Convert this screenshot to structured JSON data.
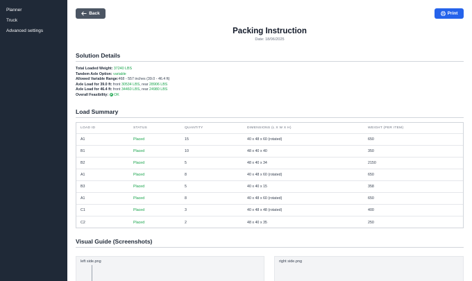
{
  "sidebar": {
    "items": [
      {
        "label": "Planner"
      },
      {
        "label": "Truck"
      },
      {
        "label": "Advanced settings"
      }
    ]
  },
  "header": {
    "back_label": "Back",
    "print_label": "Print",
    "title": "Packing Instruction",
    "date_prefix": "Date:",
    "date_value": "18/06/2025"
  },
  "solution": {
    "heading": "Solution Details",
    "total_weight_label": "Total Loaded Weight:",
    "total_weight_value": "37240 LBS",
    "tandem_label": "Tandem Axle Option:",
    "tandem_value": "variable",
    "range_label": "Allowed Variable Range:",
    "range_value": "468 - 557 inches (39.0 - 46.4 ft)",
    "axle39_label": "Axle Load for 39.0 ft:",
    "axle39_front_label": "front",
    "axle39_front_value": "30534 LBS",
    "axle39_rear_label": ", rear",
    "axle39_rear_value": "28906 LBS",
    "axle46_label": "Axle Load for 46.4 ft:",
    "axle46_front_label": "front",
    "axle46_front_value": "34460 LBS",
    "axle46_rear_label": ", rear",
    "axle46_rear_value": "24980 LBS",
    "feasibility_label": "Overall Feasibility:",
    "feasibility_value": "OK",
    "ok_color": "#16a34a"
  },
  "load_summary": {
    "heading": "Load Summary",
    "columns": [
      "LOAD ID",
      "STATUS",
      "QUANTITY",
      "DIMENSIONS (L X W X H)",
      "WEIGHT (PER ITEM)"
    ],
    "rows": [
      [
        "A1",
        "Placed",
        "15",
        "40 x 48 x 60 (rotated)",
        "650"
      ],
      [
        "B1",
        "Placed",
        "10",
        "48 x 40 x 40",
        "350"
      ],
      [
        "B2",
        "Placed",
        "5",
        "48 x 40 x 34",
        "2150"
      ],
      [
        "A1",
        "Placed",
        "8",
        "40 x 48 x 60 (rotated)",
        "650"
      ],
      [
        "B3",
        "Placed",
        "5",
        "40 x 40 x 15",
        "358"
      ],
      [
        "A1",
        "Placed",
        "8",
        "40 x 48 x 60 (rotated)",
        "650"
      ],
      [
        "C1",
        "Placed",
        "3",
        "40 x 48 x 48 (rotated)",
        "400"
      ],
      [
        "C2",
        "Placed",
        "2",
        "48 x 40 x 35",
        "250"
      ]
    ]
  },
  "visual_guide": {
    "heading": "Visual Guide (Screenshots)",
    "left_label": "left side.png",
    "right_label": "right side.png"
  }
}
